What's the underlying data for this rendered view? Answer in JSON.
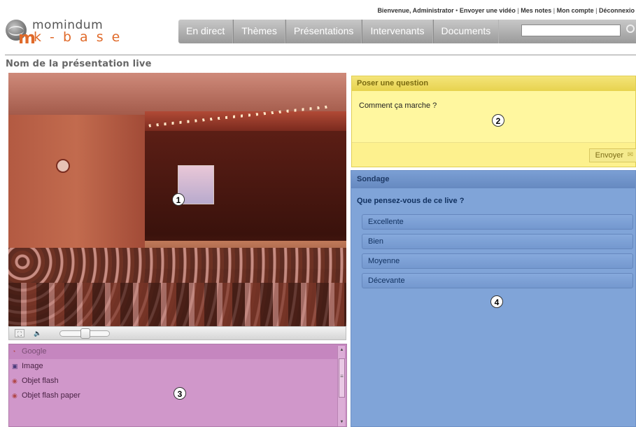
{
  "header": {
    "topbar": {
      "welcome": "Bienvenue, Administrator",
      "bullet": "•",
      "links": [
        "Envoyer une vidéo",
        "Mes notes",
        "Mon compte",
        "Déconnexio"
      ],
      "separator": "|"
    },
    "logo": {
      "line1": "momindum",
      "line2": "k - b a s e",
      "mark": "m"
    },
    "nav": [
      "En direct",
      "Thèmes",
      "Présentations",
      "Intervenants",
      "Documents"
    ],
    "search": {
      "value": "",
      "placeholder": ""
    }
  },
  "page_title": "Nom de la présentation live",
  "callouts": [
    "1",
    "2",
    "3",
    "4"
  ],
  "player": {
    "volume_level": 0.5,
    "colors": {
      "overlay": "#b0302a"
    }
  },
  "resources": {
    "items": [
      {
        "label": "Google",
        "icon": "google-icon",
        "active": true
      },
      {
        "label": "Image",
        "icon": "image-icon",
        "active": false
      },
      {
        "label": "Objet flash",
        "icon": "flash-icon",
        "active": false
      },
      {
        "label": "Objet flash paper",
        "icon": "flash-paper-icon",
        "active": false
      }
    ],
    "scroll_marker": "≡",
    "color": "#d097ca"
  },
  "question": {
    "header": "Poser une question",
    "text": "Comment ça marche ?",
    "send_label": "Envoyer",
    "color": "#fdf18e"
  },
  "poll": {
    "header": "Sondage",
    "question": "Que pensez-vous de ce live ?",
    "options": [
      "Excellente",
      "Bien",
      "Moyenne",
      "Décevante"
    ],
    "color": "#80a4d8"
  }
}
